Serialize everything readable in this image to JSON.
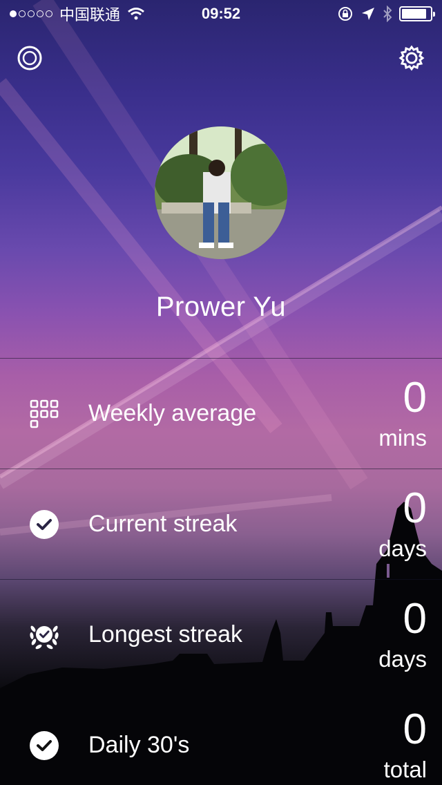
{
  "status_bar": {
    "carrier": "中国联通",
    "time": "09:52"
  },
  "icons": {
    "left_top": "target-icon",
    "right_top": "gear-icon"
  },
  "profile": {
    "name": "Prower Yu"
  },
  "stats": [
    {
      "icon": "grid-icon",
      "label": "Weekly average",
      "value": "0",
      "unit": "mins"
    },
    {
      "icon": "check-circle-icon",
      "label": "Current streak",
      "value": "0",
      "unit": "days"
    },
    {
      "icon": "laurel-check-icon",
      "label": "Longest streak",
      "value": "0",
      "unit": "days"
    },
    {
      "icon": "check-circle-icon",
      "label": "Daily 30's",
      "value": "0",
      "unit": "total"
    }
  ]
}
